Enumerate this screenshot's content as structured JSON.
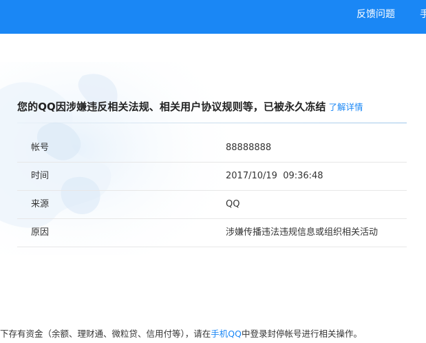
{
  "header": {
    "nav_feedback": "反馈问题",
    "nav_more": "手"
  },
  "notice": {
    "headline": "您的QQ因涉嫌违反相关法规、相关用户协议规则等，已被永久冻结",
    "learn_more": "了解详情"
  },
  "details": {
    "rows": [
      {
        "label": "帐号",
        "value": "88888888"
      },
      {
        "label": "时间",
        "value": "2017/10/19  09:36:48"
      },
      {
        "label": "来源",
        "value": "QQ"
      },
      {
        "label": "原因",
        "value": "涉嫌传播违法违规信息或组织相关活动"
      }
    ]
  },
  "footer_note": {
    "before": "下存有资金（余额、理财通、微粒贷、信用付等），请在",
    "link": "手机QQ",
    "after": "中登录封停帐号进行相关操作。"
  },
  "colors": {
    "brand_blue": "#1a87f5",
    "divider": "#e7e7e7"
  }
}
